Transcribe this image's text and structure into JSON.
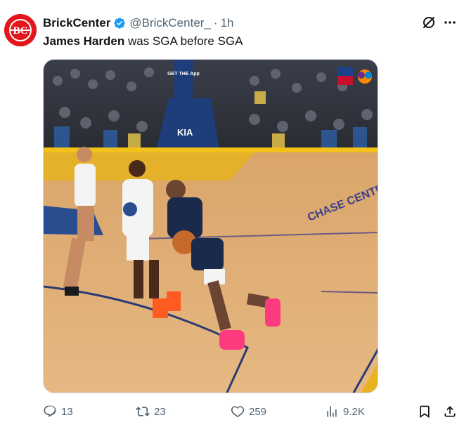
{
  "tweet": {
    "display_name": "BrickCenter",
    "handle": "@BrickCenter_",
    "separator": "·",
    "time": "1h",
    "avatar_text": "BC",
    "text_bold": "James Harden",
    "text_rest": " was SGA before SGA"
  },
  "media": {
    "overlay_banner_text": "GET THE App",
    "sponsor_text": "KIA",
    "pad_text": "CHASE CENTER",
    "pad_brand": "nbcsports"
  },
  "stats": {
    "replies": "13",
    "retweets": "23",
    "likes": "259",
    "views": "9.2K"
  },
  "colors": {
    "accent": "#1d9bf0",
    "muted": "#536471",
    "avatar_bg": "#e3161b"
  },
  "icons": {
    "verified": "verified-badge-icon",
    "grok": "grok-icon",
    "more": "more-icon",
    "reply": "reply-icon",
    "retweet": "retweet-icon",
    "like": "heart-icon",
    "views": "views-icon",
    "bookmark": "bookmark-icon",
    "share": "share-icon"
  }
}
